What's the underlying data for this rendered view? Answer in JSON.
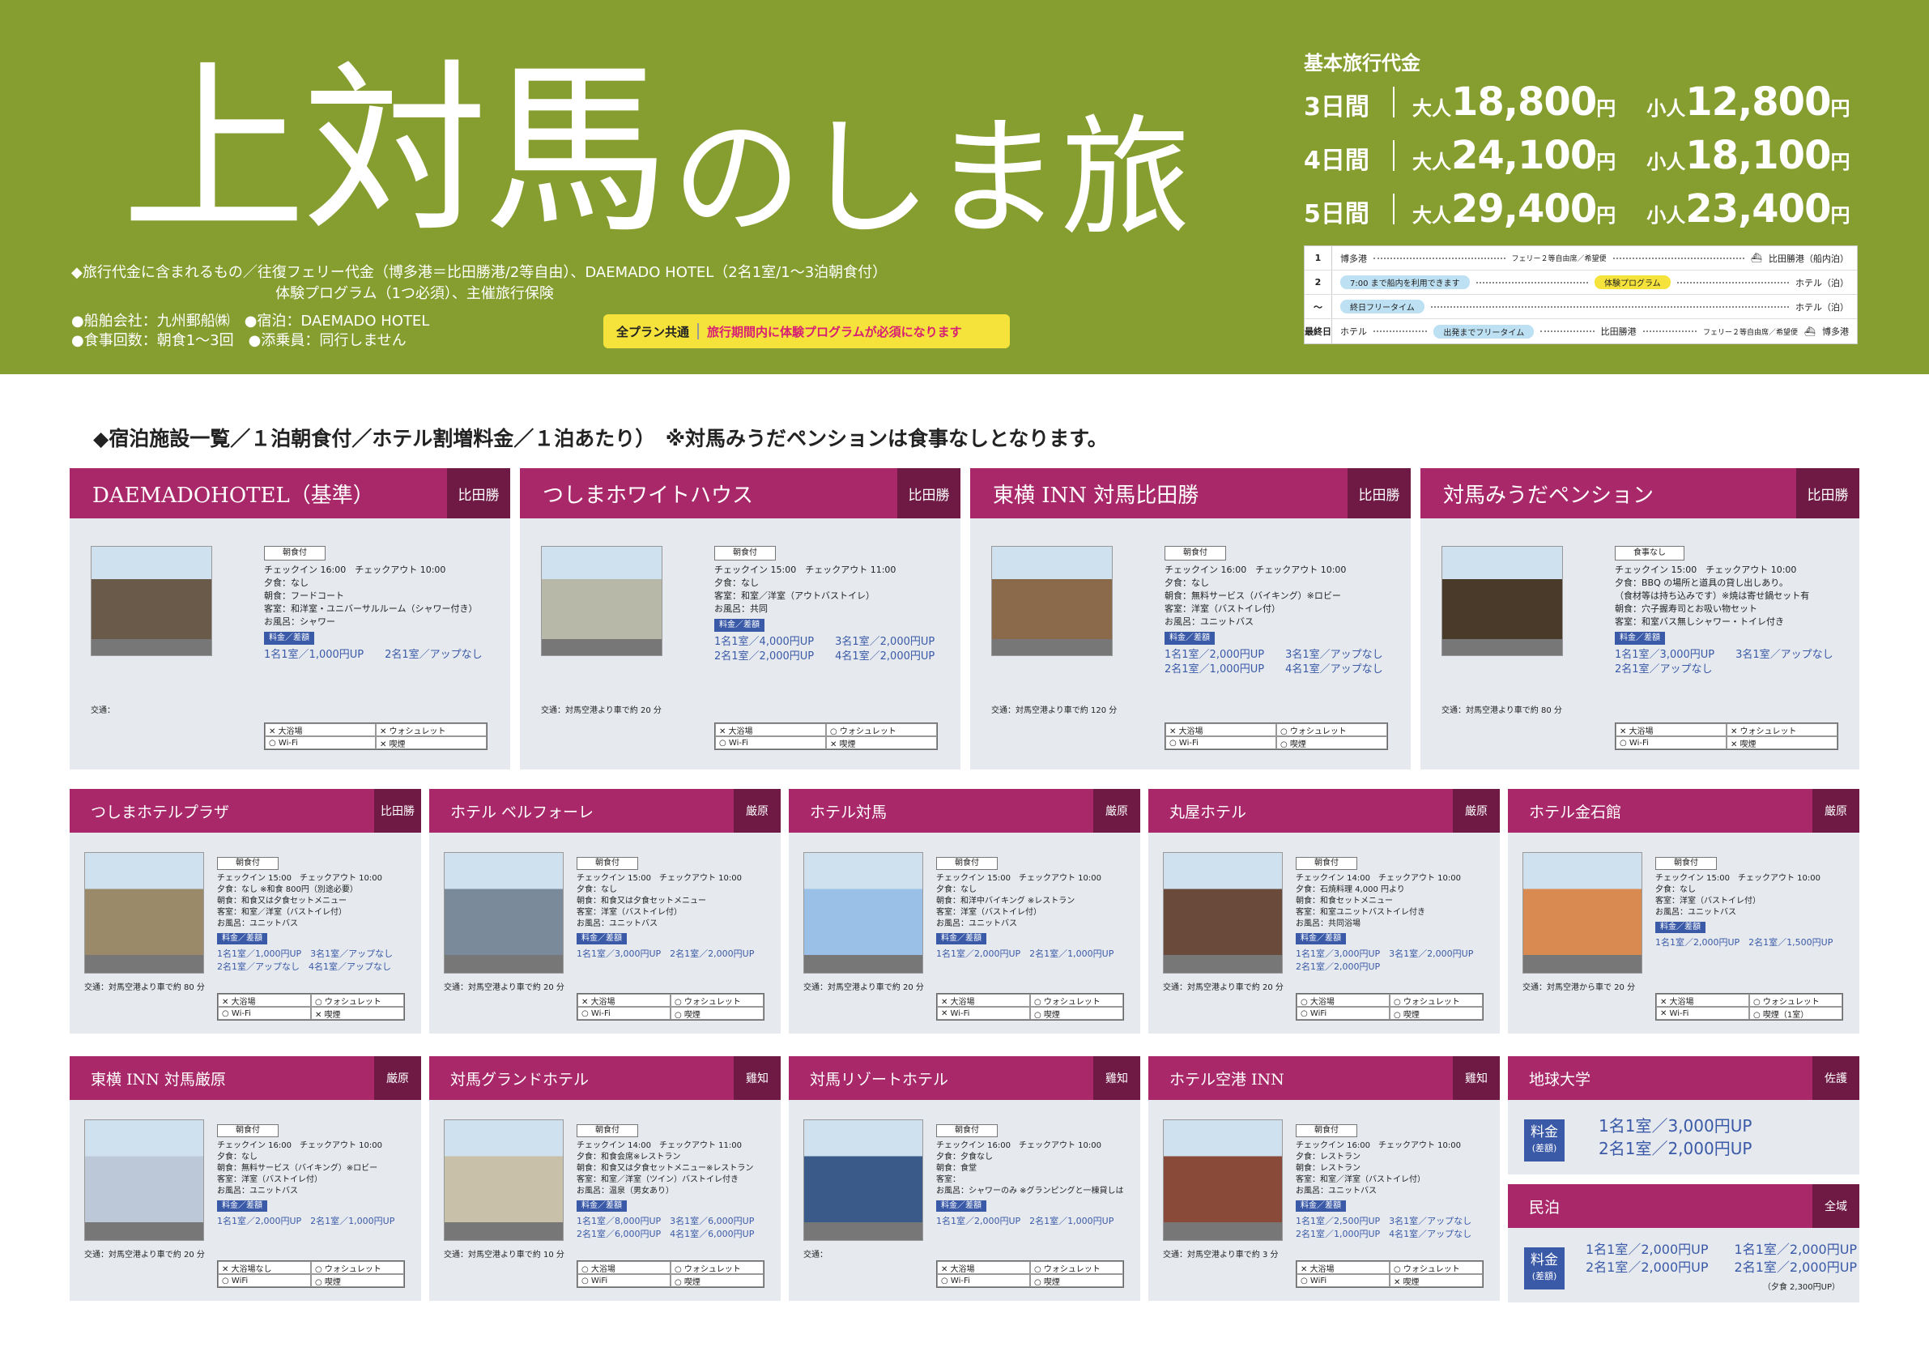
{
  "header": {
    "title_big": "上対馬",
    "title_small": "のしま旅",
    "included_line1": "◆旅行代金に含まれるもの／往復フェリー代金（博多港＝比田勝港/2等自由）、DAEMADO HOTEL（2名1室/1〜3泊朝食付）",
    "included_line2": "体験プログラム（1つ必須）、主催旅行保険",
    "info_line1": "●船舶会社：九州郵船㈱　●宿泊：DAEMADO HOTEL",
    "info_line2": "●食事回数：朝食1〜3回　●添乗員：同行しません",
    "banner_label": "全プラン共通",
    "banner_msg": "旅行期間内に体験プログラムが必須になります"
  },
  "pricing": {
    "label": "基本旅行代金",
    "rows": [
      {
        "days": "3日間",
        "adult_label": "大人",
        "adult": "18,800",
        "child_label": "小人",
        "child": "12,800",
        "yen": "円"
      },
      {
        "days": "4日間",
        "adult_label": "大人",
        "adult": "24,100",
        "child_label": "小人",
        "child": "18,100",
        "yen": "円"
      },
      {
        "days": "5日間",
        "adult_label": "大人",
        "adult": "29,400",
        "child_label": "小人",
        "child": "23,400",
        "yen": "円"
      }
    ]
  },
  "schedule": {
    "rows": [
      {
        "day": "1",
        "from": "博多港",
        "note": "フェリー２等自由席／希望便",
        "to": "比田勝港（船内泊）"
      },
      {
        "day": "2",
        "from": "7:00 まで船内を利用できます",
        "note": "体験プログラム",
        "to": "ホテル（泊）"
      },
      {
        "day": "〜",
        "from": "終日フリータイム",
        "note": "",
        "to": "ホテル（泊）"
      },
      {
        "day": "最終日",
        "from": "ホテル",
        "note": "出発までフリータイム",
        "mid": "比田勝港",
        "note2": "フェリー２等自由席／希望便",
        "to": "博多港"
      }
    ]
  },
  "list_heading": "◆宿泊施設一覧／１泊朝食付／ホテル割増料金／１泊あたり）　※対馬みうだペンションは食事なしとなります。",
  "hotels": [
    {
      "name": "DAEMADOHOTEL（基準）",
      "area": "比田勝",
      "meal": "朝食付",
      "check": "チェックイン 16:00　チェックアウト 10:00",
      "l1": "夕食：なし",
      "l2": "朝食：フードコート",
      "l3": "客室：和洋室・ユニバーサルルーム（シャワー付き）",
      "l4": "お風呂：シャワー",
      "fee_label": "料金／差額",
      "fee1": "1名1室／1,000円UP　　2名1室／アップなし",
      "fee2": "",
      "access": "交通：",
      "a1": "✕ 大浴場",
      "a2": "✕ ウォシュレット",
      "a3": "○ Wi-Fi",
      "a4": "✕ 喫煙"
    },
    {
      "name": "つしまホワイトハウス",
      "area": "比田勝",
      "meal": "朝食付",
      "check": "チェックイン 15:00　チェックアウト 11:00",
      "l1": "夕食：なし",
      "l2": "客室：和室／洋室（アウトバストイレ）",
      "l3": "お風呂：共同",
      "l4": "",
      "fee_label": "料金／差額",
      "fee1": "1名1室／4,000円UP　　3名1室／2,000円UP",
      "fee2": "2名1室／2,000円UP　　4名1室／2,000円UP",
      "access": "交通：対馬空港より車で約 20 分",
      "a1": "✕ 大浴場",
      "a2": "○ ウォシュレット",
      "a3": "○ Wi-Fi",
      "a4": "✕ 喫煙"
    },
    {
      "name": "東横 INN 対馬比田勝",
      "area": "比田勝",
      "meal": "朝食付",
      "check": "チェックイン 16:00　チェックアウト 10:00",
      "l1": "夕食：なし",
      "l2": "朝食：無料サービス（バイキング）※ロビー",
      "l3": "客室：洋室（バストイレ付）",
      "l4": "お風呂：ユニットバス",
      "fee_label": "料金／差額",
      "fee1": "1名1室／2,000円UP　　3名1室／アップなし",
      "fee2": "2名1室／1,000円UP　　4名1室／アップなし",
      "access": "交通：対馬空港より車で約 120 分",
      "a1": "✕ 大浴場",
      "a2": "○ ウォシュレット",
      "a3": "○ Wi-Fi",
      "a4": "○ 喫煙"
    },
    {
      "name": "対馬みうだペンション",
      "area": "比田勝",
      "meal": "食事なし",
      "check": "チェックイン 15:00　チェックアウト 10:00",
      "l1": "夕食：BBQ の場所と道具の貸し出しあり。",
      "l2": "（食材等は持ち込みです）※焼は寄せ鍋セット有",
      "l3": "朝食：穴子握寿司とお吸い物セット",
      "l4": "客室：和室バス無しシャワー・トイレ付き",
      "fee_label": "料金／差額",
      "fee1": "1名1室／3,000円UP　　3名1室／アップなし",
      "fee2": "2名1室／アップなし",
      "access": "交通：対馬空港より車で約 80 分",
      "a1": "✕ 大浴場",
      "a2": "✕ ウォシュレット",
      "a3": "○ Wi-Fi",
      "a4": "✕ 喫煙"
    },
    {
      "name": "つしまホテルプラザ",
      "area": "比田勝",
      "meal": "朝食付",
      "check": "チェックイン 15:00　チェックアウト 10:00",
      "l1": "夕食：なし ※和食 800円（別途必要）",
      "l2": "朝食：和食又は夕食セットメニュー",
      "l3": "客室：和室／洋室（バストイレ付）",
      "l4": "お風呂：ユニットバス",
      "fee_label": "料金／差額",
      "fee1": "1名1室／1,000円UP　3名1室／アップなし",
      "fee2": "2名1室／アップなし　4名1室／アップなし",
      "access": "交通：対馬空港より車で約 80 分",
      "a1": "✕ 大浴場",
      "a2": "○ ウォシュレット",
      "a3": "○ Wi-Fi",
      "a4": "✕ 喫煙"
    },
    {
      "name": "ホテル ベルフォーレ",
      "area": "厳原",
      "meal": "朝食付",
      "check": "チェックイン 15:00　チェックアウト 10:00",
      "l1": "夕食：なし",
      "l2": "朝食：和食又は夕食セットメニュー",
      "l3": "客室：洋室（バストイレ付）",
      "l4": "お風呂：ユニットバス",
      "fee_label": "料金／差額",
      "fee1": "1名1室／3,000円UP　2名1室／2,000円UP",
      "fee2": "",
      "access": "交通：対馬空港より車で約 20 分",
      "a1": "✕ 大浴場",
      "a2": "○ ウォシュレット",
      "a3": "○ Wi-Fi",
      "a4": "○ 喫煙"
    },
    {
      "name": "ホテル対馬",
      "area": "厳原",
      "meal": "朝食付",
      "check": "チェックイン 15:00　チェックアウト 10:00",
      "l1": "夕食：なし",
      "l2": "朝食：和洋中バイキング ※レストラン",
      "l3": "客室：洋室（バストイレ付）",
      "l4": "お風呂：ユニットバス",
      "fee_label": "料金／差額",
      "fee1": "1名1室／2,000円UP　2名1室／1,000円UP",
      "fee2": "",
      "access": "交通：対馬空港より車で約 20 分",
      "a1": "✕ 大浴場",
      "a2": "○ ウォシュレット",
      "a3": "✕ Wi-Fi",
      "a4": "○ 喫煙"
    },
    {
      "name": "丸屋ホテル",
      "area": "厳原",
      "meal": "朝食付",
      "check": "チェックイン 14:00　チェックアウト 10:00",
      "l1": "夕食：石焼料理 4,000 円より",
      "l2": "朝食：和食セットメニュー",
      "l3": "客室：和室ユニットバストイレ付き",
      "l4": "お風呂：共同浴場",
      "fee_label": "料金／差額",
      "fee1": "1名1室／3,000円UP　3名1室／2,000円UP",
      "fee2": "2名1室／2,000円UP",
      "access": "交通：対馬空港より車で約 20 分",
      "a1": "○ 大浴場",
      "a2": "○ ウォシュレット",
      "a3": "○ WiFi",
      "a4": "○ 喫煙"
    },
    {
      "name": "ホテル金石館",
      "area": "厳原",
      "meal": "朝食付",
      "check": "チェックイン 15:00　チェックアウト 10:00",
      "l1": "夕食：なし",
      "l2": "客室：洋室（バストイレ付）",
      "l3": "お風呂：ユニットバス",
      "l4": "",
      "fee_label": "料金／差額",
      "fee1": "1名1室／2,000円UP　2名1室／1,500円UP",
      "fee2": "",
      "access": "交通：対馬空港から車で 20 分",
      "a1": "✕ 大浴場",
      "a2": "○ ウォシュレット",
      "a3": "✕ Wi-Fi",
      "a4": "○ 喫煙（1室）"
    },
    {
      "name": "東横 INN 対馬厳原",
      "area": "厳原",
      "meal": "朝食付",
      "check": "チェックイン 16:00　チェックアウト 10:00",
      "l1": "夕食：なし",
      "l2": "朝食：無料サービス（バイキング）※ロビー",
      "l3": "客室：洋室（バストイレ付）",
      "l4": "お風呂：ユニットバス",
      "fee_label": "料金／差額",
      "fee1": "1名1室／2,000円UP　2名1室／1,000円UP",
      "fee2": "",
      "access": "交通：対馬空港より車で約 20 分",
      "a1": "✕ 大浴場なし",
      "a2": "○ ウォシュレット",
      "a3": "○ WiFi",
      "a4": "○ 喫煙"
    },
    {
      "name": "対馬グランドホテル",
      "area": "雞知",
      "meal": "朝食付",
      "check": "チェックイン 14:00　チェックアウト 11:00",
      "l1": "夕食：和食会席※レストラン",
      "l2": "朝食：和食又は夕食セットメニュー※レストラン",
      "l3": "客室：和室／洋室（ツイン）バストイレ付き",
      "l4": "お風呂：温泉（男女あり）",
      "fee_label": "料金／差額",
      "fee1": "1名1室／8,000円UP　3名1室／6,000円UP",
      "fee2": "2名1室／6,000円UP　4名1室／6,000円UP",
      "access": "交通：対馬空港より車で約 10 分",
      "a1": "○ 大浴場",
      "a2": "○ ウォシュレット",
      "a3": "○ WiFi",
      "a4": "○ 喫煙"
    },
    {
      "name": "対馬リゾートホテル",
      "area": "雞知",
      "meal": "朝食付",
      "check": "チェックイン 16:00　チェックアウト 10:00",
      "l1": "夕食：夕食なし",
      "l2": "朝食：食堂",
      "l3": "客室：",
      "l4": "お風呂：シャワーのみ ※グランピングと一棟貸しは",
      "fee_label": "料金／差額",
      "fee1": "1名1室／2,000円UP　2名1室／1,000円UP",
      "fee2": "",
      "access": "交通：",
      "a1": "✕ 大浴場",
      "a2": "○ ウォシュレット",
      "a3": "○ Wi-Fi",
      "a4": "○ 喫煙"
    },
    {
      "name": "ホテル空港 INN",
      "area": "雞知",
      "meal": "朝食付",
      "check": "チェックイン 16:00　チェックアウト 10:00",
      "l1": "夕食：レストラン",
      "l2": "朝食：レストラン",
      "l3": "客室：和室／洋室（バストイレ付）",
      "l4": "お風呂：ユニットバス",
      "fee_label": "料金／差額",
      "fee1": "1名1室／2,500円UP　3名1室／アップなし",
      "fee2": "2名1室／1,000円UP　4名1室／アップなし",
      "access": "交通：対馬空港より車で約 3 分",
      "a1": "✕ 大浴場",
      "a2": "○ ウォシュレット",
      "a3": "○ WiFi",
      "a4": "✕ 喫煙"
    }
  ],
  "extra": {
    "chikyu_name": "地球大学",
    "chikyu_area": "佐護",
    "chikyu_fee_label": "料金",
    "chikyu_fee_sub": "(差額)",
    "chikyu_f1": "1名1室／3,000円UP",
    "chikyu_f2": "2名1室／2,000円UP",
    "minpaku_name": "民泊",
    "minpaku_area": "全域",
    "minpaku_fee_label": "料金",
    "minpaku_fee_sub": "(差額)",
    "minpaku_f1": "1名1室／2,000円UP　　1名1室／2,000円UP",
    "minpaku_f2": "2名1室／2,000円UP　　2名1室／2,000円UP",
    "minpaku_note": "（夕食 2,300円UP）"
  }
}
